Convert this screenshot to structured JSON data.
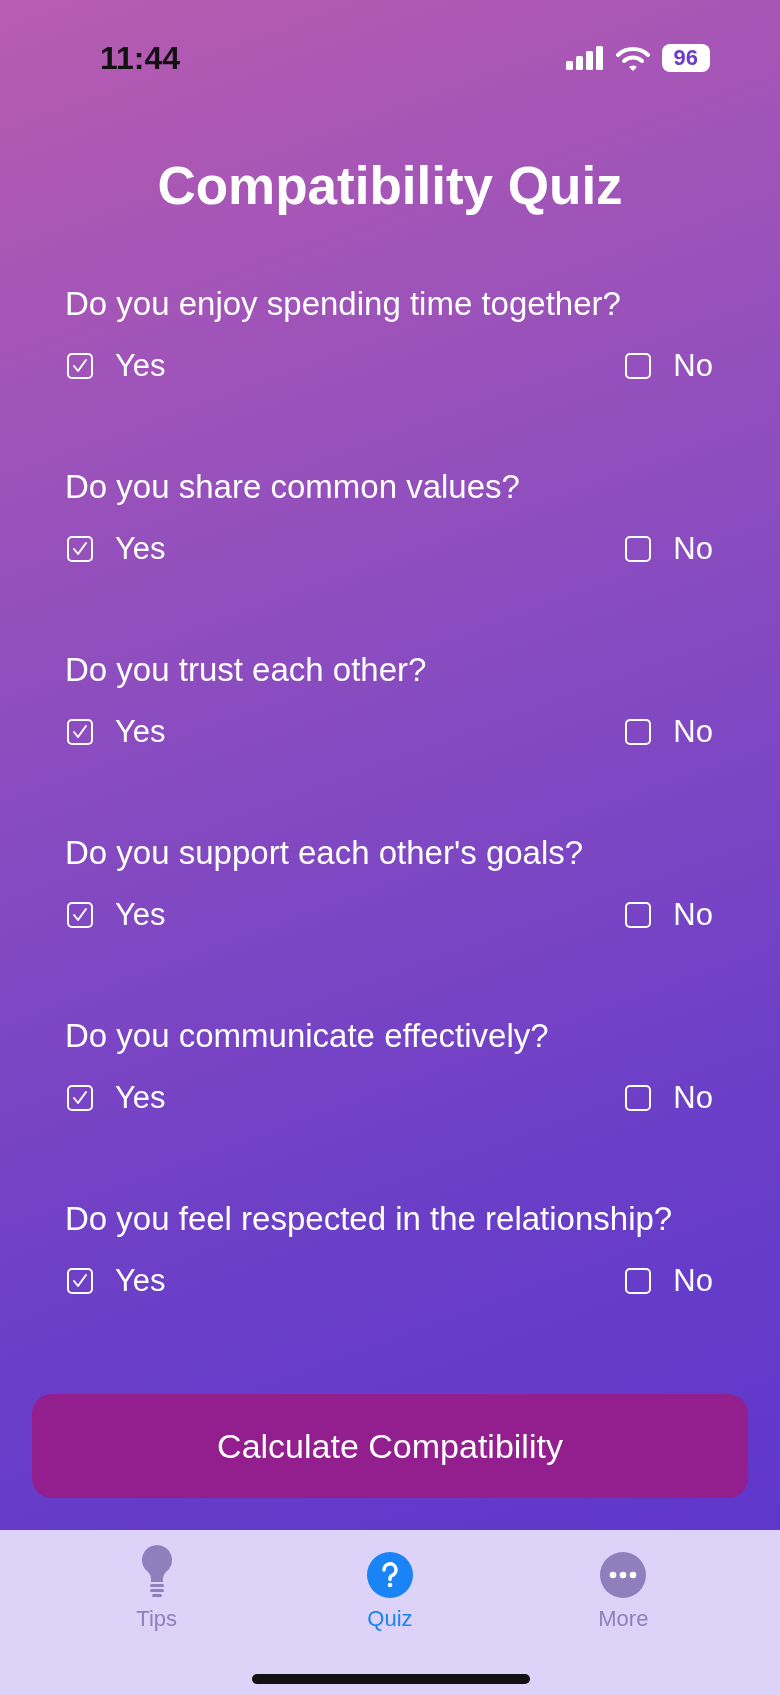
{
  "status_bar": {
    "time": "11:44",
    "battery": "96"
  },
  "title": "Compatibility Quiz",
  "questions": [
    {
      "text": "Do you enjoy spending time together?",
      "options": [
        {
          "label": "Yes",
          "checked": true
        },
        {
          "label": "No",
          "checked": false
        }
      ]
    },
    {
      "text": "Do you share common values?",
      "options": [
        {
          "label": "Yes",
          "checked": true
        },
        {
          "label": "No",
          "checked": false
        }
      ]
    },
    {
      "text": "Do you trust each other?",
      "options": [
        {
          "label": "Yes",
          "checked": true
        },
        {
          "label": "No",
          "checked": false
        }
      ]
    },
    {
      "text": "Do you support each other's goals?",
      "options": [
        {
          "label": "Yes",
          "checked": true
        },
        {
          "label": "No",
          "checked": false
        }
      ]
    },
    {
      "text": "Do you communicate effectively?",
      "options": [
        {
          "label": "Yes",
          "checked": true
        },
        {
          "label": "No",
          "checked": false
        }
      ]
    },
    {
      "text": "Do you feel respected in the relationship?",
      "options": [
        {
          "label": "Yes",
          "checked": true
        },
        {
          "label": "No",
          "checked": false
        }
      ]
    }
  ],
  "action_button": "Calculate Compatibility",
  "tabs": [
    {
      "label": "Tips",
      "kind": "bulb",
      "selected": false
    },
    {
      "label": "Quiz",
      "kind": "question",
      "selected": true
    },
    {
      "label": "More",
      "kind": "more",
      "selected": false
    }
  ]
}
